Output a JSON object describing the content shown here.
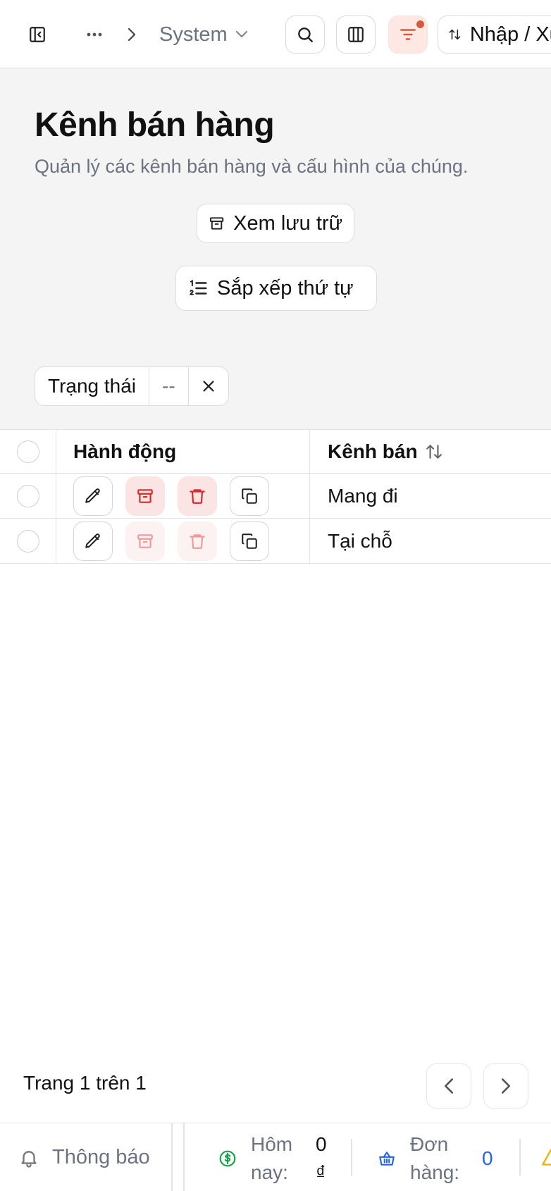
{
  "topbar": {
    "breadcrumb_more": "···",
    "breadcrumb_current": "System",
    "import_export_label": "Nhập / Xuất"
  },
  "header": {
    "title": "Kênh bán hàng",
    "subtitle": "Quản lý các kênh bán hàng và cấu hình của chúng.",
    "archive_view_label": "Xem lưu trữ",
    "sort_order_label": "Sắp xếp thứ tự"
  },
  "filter": {
    "label": "Trạng thái",
    "value": "--"
  },
  "table": {
    "columns": [
      "Hành động",
      "Kênh bán"
    ],
    "rows": [
      {
        "channel": "Mang đi",
        "archive_enabled": true,
        "delete_enabled": true
      },
      {
        "channel": "Tại chỗ",
        "archive_enabled": false,
        "delete_enabled": false
      }
    ]
  },
  "pagination": {
    "info": "Trang 1 trên 1"
  },
  "footer": {
    "notifications_label": "Thông báo",
    "today_label": "Hôm nay:",
    "today_value": "0 ₫",
    "orders_label": "Đơn hàng:",
    "orders_value": "0"
  },
  "colors": {
    "accent": "#d9573d",
    "danger": "#d62b2b",
    "money_green": "#16a34a",
    "orders_blue": "#2563eb"
  }
}
